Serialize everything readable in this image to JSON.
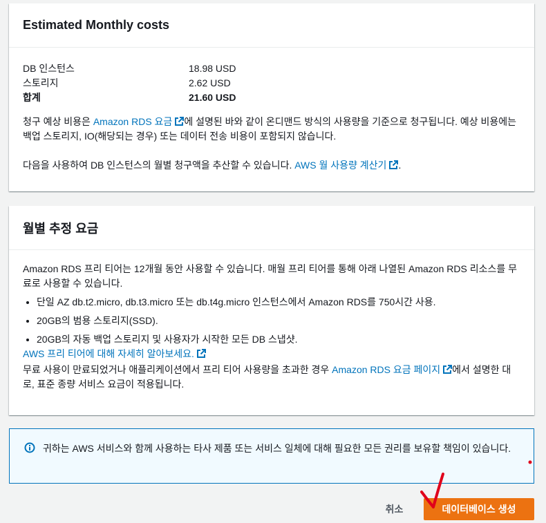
{
  "estimated_costs": {
    "title": "Estimated Monthly costs",
    "rows": [
      {
        "label": "DB 인스턴스",
        "value": "18.98 USD"
      },
      {
        "label": "스토리지",
        "value": "2.62 USD"
      },
      {
        "label": "합계",
        "value": "21.60 USD"
      }
    ],
    "desc1_before": "청구 예상 비용은 ",
    "desc1_link": "Amazon RDS 요금",
    "desc1_after": "에 설명된 바와 같이 온디맨드 방식의 사용량을 기준으로 청구됩니다. 예상 비용에는 백업 스토리지, IO(해당되는 경우) 또는 데이터 전송 비용이 포함되지 않습니다.",
    "desc2_before": "다음을 사용하여 DB 인스턴스의 월별 청구액을 추산할 수 있습니다. ",
    "desc2_link": "AWS 월 사용량 계산기",
    "desc2_after": "."
  },
  "monthly_fee": {
    "title": "월별 추정 요금",
    "intro": "Amazon RDS 프리 티어는 12개월 동안 사용할 수 있습니다. 매월 프리 티어를 통해 아래 나열된 Amazon RDS 리소스를 무료로 사용할 수 있습니다.",
    "bullets": [
      "단일 AZ db.t2.micro, db.t3.micro 또는 db.t4g.micro 인스턴스에서 Amazon RDS를 750시간 사용.",
      "20GB의 범용 스토리지(SSD).",
      "20GB의 자동 백업 스토리지 및 사용자가 시작한 모든 DB 스냅샷."
    ],
    "learn_more_link": "AWS 프리 티어에 대해 자세히 알아보세요.",
    "outro_before": "무료 사용이 만료되었거나 애플리케이션에서 프리 티어 사용량을 초과한 경우 ",
    "outro_link": "Amazon RDS 요금 페이지",
    "outro_after": "에서 설명한 대로, 표준 종량 서비스 요금이 적용됩니다."
  },
  "info": {
    "text": "귀하는 AWS 서비스와 함께 사용하는 타사 제품 또는 서비스 일체에 대해 필요한 모든 권리를 보유할 책임이 있습니다."
  },
  "actions": {
    "cancel_label": "취소",
    "create_label": "데이터베이스 생성"
  },
  "colors": {
    "link": "#0073bb",
    "primary": "#ec7211",
    "info_bg": "#f1faff",
    "annotation": "#e0001b"
  },
  "icons": [
    "external-link-icon",
    "info-icon"
  ]
}
